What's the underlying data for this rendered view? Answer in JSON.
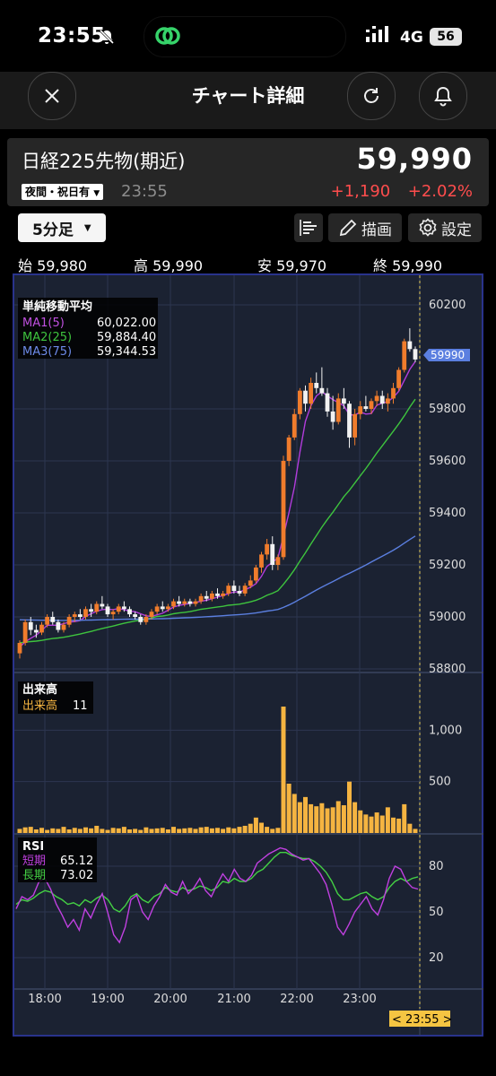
{
  "status_bar": {
    "time": "23:55",
    "network": "4G",
    "battery": "56"
  },
  "nav": {
    "title": "チャート詳細"
  },
  "instrument": {
    "name": "日経225先物(期近)",
    "price": "59,990",
    "session_label": "夜間・祝日有",
    "session_time": "23:55",
    "change": "+1,190",
    "change_pct": "+2.02%"
  },
  "toolbar": {
    "timeframe": "5分足",
    "draw_label": "描画",
    "settings_label": "設定"
  },
  "ohlc": {
    "open_label": "始",
    "open": "59,980",
    "high_label": "高",
    "high": "59,990",
    "low_label": "安",
    "low": "59,970",
    "close_label": "終",
    "close": "59,990"
  },
  "legend": {
    "sma_title": "単純移動平均",
    "ma1_label": "MA1(5)",
    "ma1_value": "60,022.00",
    "ma2_label": "MA2(25)",
    "ma2_value": "59,884.40",
    "ma3_label": "MA3(75)",
    "ma3_value": "59,344.53",
    "vol_title": "出来高",
    "vol_label": "出来高",
    "vol_value": "11",
    "rsi_title": "RSI",
    "rsi_short_label": "短期",
    "rsi_short_value": "65.12",
    "rsi_long_label": "長期",
    "rsi_long_value": "73.02"
  },
  "current_price_tag": "59990",
  "crosshair_time": "< 23:55 >",
  "colors": {
    "up": "#f07c2c",
    "down": "#f2f2f2",
    "ma1": "#b23cdc",
    "ma2": "#3ec43e",
    "ma3": "#5b7fe0",
    "volume": "#f5b441",
    "rsi_short": "#c040e0",
    "rsi_long": "#44d044",
    "change": "#ff4d4d",
    "panel_bg": "#1b2232",
    "panel_border": "#29338c"
  },
  "chart_data": {
    "type": "candlestick",
    "price_axis": {
      "ticks": [
        60200,
        59800,
        59600,
        59400,
        59200,
        59000,
        58800
      ],
      "range": [
        58750,
        60250
      ]
    },
    "time_axis": {
      "ticks": [
        "18:00",
        "19:00",
        "20:00",
        "21:00",
        "22:00",
        "23:00"
      ]
    },
    "candles_ohlc": [
      [
        58860,
        58910,
        58840,
        58900
      ],
      [
        58900,
        58990,
        58890,
        58980
      ],
      [
        58980,
        59000,
        58930,
        58950
      ],
      [
        58950,
        58970,
        58920,
        58940
      ],
      [
        58940,
        58980,
        58930,
        58970
      ],
      [
        58970,
        59010,
        58960,
        59000
      ],
      [
        59000,
        59020,
        58970,
        58980
      ],
      [
        58980,
        58990,
        58940,
        58950
      ],
      [
        58950,
        58980,
        58940,
        58970
      ],
      [
        58970,
        59010,
        58960,
        59000
      ],
      [
        59000,
        59020,
        58980,
        59010
      ],
      [
        59010,
        59030,
        58990,
        59000
      ],
      [
        59000,
        59040,
        58990,
        59030
      ],
      [
        59030,
        59050,
        59000,
        59020
      ],
      [
        59020,
        59060,
        59010,
        59050
      ],
      [
        59050,
        59080,
        59030,
        59040
      ],
      [
        59040,
        59050,
        59000,
        59010
      ],
      [
        59010,
        59030,
        58990,
        59020
      ],
      [
        59020,
        59050,
        59010,
        59040
      ],
      [
        59040,
        59060,
        59020,
        59030
      ],
      [
        59030,
        59040,
        59000,
        59010
      ],
      [
        59010,
        59020,
        58990,
        59000
      ],
      [
        59000,
        59010,
        58970,
        58980
      ],
      [
        58980,
        59010,
        58970,
        59000
      ],
      [
        59000,
        59030,
        58990,
        59020
      ],
      [
        59020,
        59050,
        59010,
        59040
      ],
      [
        59040,
        59060,
        59020,
        59030
      ],
      [
        59030,
        59050,
        59020,
        59040
      ],
      [
        59040,
        59070,
        59030,
        59060
      ],
      [
        59060,
        59080,
        59040,
        59050
      ],
      [
        59050,
        59070,
        59040,
        59060
      ],
      [
        59060,
        59070,
        59040,
        59050
      ],
      [
        59050,
        59070,
        59040,
        59060
      ],
      [
        59060,
        59090,
        59050,
        59080
      ],
      [
        59080,
        59100,
        59060,
        59070
      ],
      [
        59070,
        59100,
        59060,
        59090
      ],
      [
        59090,
        59110,
        59070,
        59080
      ],
      [
        59080,
        59100,
        59070,
        59090
      ],
      [
        59090,
        59130,
        59080,
        59120
      ],
      [
        59120,
        59140,
        59090,
        59100
      ],
      [
        59100,
        59120,
        59080,
        59090
      ],
      [
        59090,
        59130,
        59080,
        59120
      ],
      [
        59120,
        59160,
        59110,
        59140
      ],
      [
        59140,
        59200,
        59130,
        59190
      ],
      [
        59190,
        59250,
        59170,
        59240
      ],
      [
        59240,
        59300,
        59220,
        59280
      ],
      [
        59280,
        59310,
        59180,
        59200
      ],
      [
        59200,
        59240,
        59180,
        59230
      ],
      [
        59230,
        59620,
        59220,
        59600
      ],
      [
        59600,
        59700,
        59580,
        59690
      ],
      [
        59690,
        59800,
        59680,
        59780
      ],
      [
        59780,
        59880,
        59760,
        59870
      ],
      [
        59870,
        59890,
        59790,
        59820
      ],
      [
        59820,
        59920,
        59800,
        59900
      ],
      [
        59900,
        59940,
        59860,
        59880
      ],
      [
        59880,
        59960,
        59850,
        59860
      ],
      [
        59860,
        59880,
        59770,
        59790
      ],
      [
        59790,
        59850,
        59720,
        59750
      ],
      [
        59750,
        59860,
        59740,
        59840
      ],
      [
        59840,
        59880,
        59800,
        59820
      ],
      [
        59820,
        59830,
        59650,
        59690
      ],
      [
        59690,
        59800,
        59660,
        59780
      ],
      [
        59780,
        59830,
        59760,
        59810
      ],
      [
        59810,
        59850,
        59790,
        59800
      ],
      [
        59800,
        59840,
        59780,
        59830
      ],
      [
        59830,
        59870,
        59810,
        59850
      ],
      [
        59850,
        59870,
        59800,
        59820
      ],
      [
        59820,
        59860,
        59790,
        59840
      ],
      [
        59840,
        59900,
        59820,
        59880
      ],
      [
        59880,
        59960,
        59870,
        59950
      ],
      [
        59950,
        60070,
        59940,
        60060
      ],
      [
        60060,
        60110,
        60020,
        60030
      ],
      [
        60030,
        60040,
        59980,
        59990
      ]
    ],
    "volume": [
      40,
      55,
      60,
      35,
      50,
      30,
      45,
      40,
      60,
      35,
      50,
      40,
      55,
      45,
      70,
      40,
      30,
      50,
      45,
      60,
      35,
      40,
      30,
      55,
      40,
      45,
      50,
      35,
      60,
      40,
      45,
      50,
      40,
      55,
      60,
      45,
      50,
      40,
      55,
      45,
      60,
      70,
      90,
      150,
      100,
      60,
      40,
      50,
      1230,
      480,
      380,
      300,
      350,
      280,
      260,
      290,
      240,
      250,
      310,
      270,
      500,
      300,
      220,
      180,
      160,
      200,
      170,
      250,
      150,
      140,
      280,
      90,
      40
    ],
    "rsi_short": [
      52,
      60,
      58,
      61,
      70,
      72,
      65,
      55,
      48,
      40,
      45,
      38,
      52,
      46,
      55,
      62,
      49,
      35,
      30,
      40,
      58,
      61,
      50,
      45,
      54,
      60,
      68,
      63,
      61,
      70,
      62,
      66,
      72,
      64,
      60,
      68,
      75,
      70,
      78,
      72,
      70,
      74,
      82,
      85,
      88,
      90,
      92,
      91,
      88,
      86,
      84,
      85,
      80,
      75,
      68,
      55,
      40,
      35,
      42,
      50,
      55,
      60,
      52,
      48,
      58,
      72,
      80,
      78,
      70,
      66,
      65
    ],
    "rsi_long": [
      55,
      58,
      57,
      59,
      62,
      64,
      63,
      60,
      58,
      55,
      56,
      54,
      58,
      56,
      59,
      61,
      58,
      52,
      50,
      54,
      60,
      62,
      58,
      56,
      60,
      62,
      66,
      64,
      63,
      66,
      64,
      65,
      67,
      66,
      64,
      66,
      70,
      69,
      72,
      70,
      70,
      72,
      76,
      78,
      82,
      86,
      89,
      89,
      87,
      86,
      85,
      85,
      83,
      80,
      76,
      70,
      62,
      58,
      58,
      60,
      62,
      63,
      60,
      58,
      60,
      66,
      70,
      72,
      70,
      72,
      73
    ]
  }
}
